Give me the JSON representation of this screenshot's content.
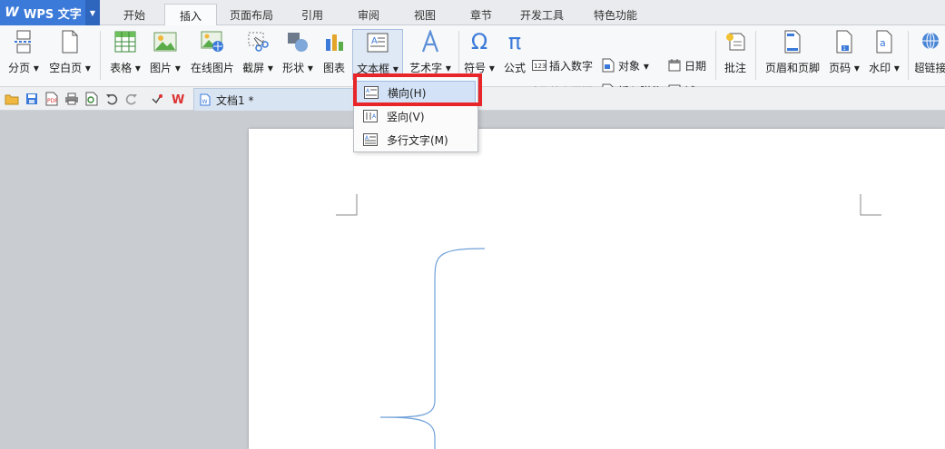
{
  "app": {
    "brand": "WPS 文字"
  },
  "tabs": [
    {
      "label": "开始"
    },
    {
      "label": "插入"
    },
    {
      "label": "页面布局"
    },
    {
      "label": "引用"
    },
    {
      "label": "审阅"
    },
    {
      "label": "视图"
    },
    {
      "label": "章节"
    },
    {
      "label": "开发工具"
    },
    {
      "label": "特色功能"
    }
  ],
  "active_tab": "插入",
  "ribbon": {
    "page_break": "分页 ▾",
    "blank_page": "空白页 ▾",
    "table": "表格 ▾",
    "picture": "图片 ▾",
    "online_picture": "在线图片",
    "screenshot": "截屏 ▾",
    "shape": "形状 ▾",
    "chart": "图表",
    "textbox": "文本框 ▾",
    "wordart": "艺术字 ▾",
    "symbol": "符号 ▾",
    "formula": "公式",
    "insert_number": "插入数字",
    "object": "对象 ▾",
    "date": "日期",
    "drop_cap": "首字下沉",
    "insert_attachment": "插入附件",
    "field": "域",
    "comment": "批注",
    "header_footer": "页眉和页脚",
    "page_number": "页码 ▾",
    "watermark": "水印 ▾",
    "hyperlink": "超链接"
  },
  "qat": {
    "doc_tab_label": "文档1 *"
  },
  "dropdown": {
    "items": [
      {
        "label": "横向(H)"
      },
      {
        "label": "竖向(V)"
      },
      {
        "label": "多行文字(M)"
      }
    ]
  },
  "colors": {
    "accent": "#3b7ad9",
    "highlight": "#e8262a",
    "brace": "#6fa0d8"
  }
}
